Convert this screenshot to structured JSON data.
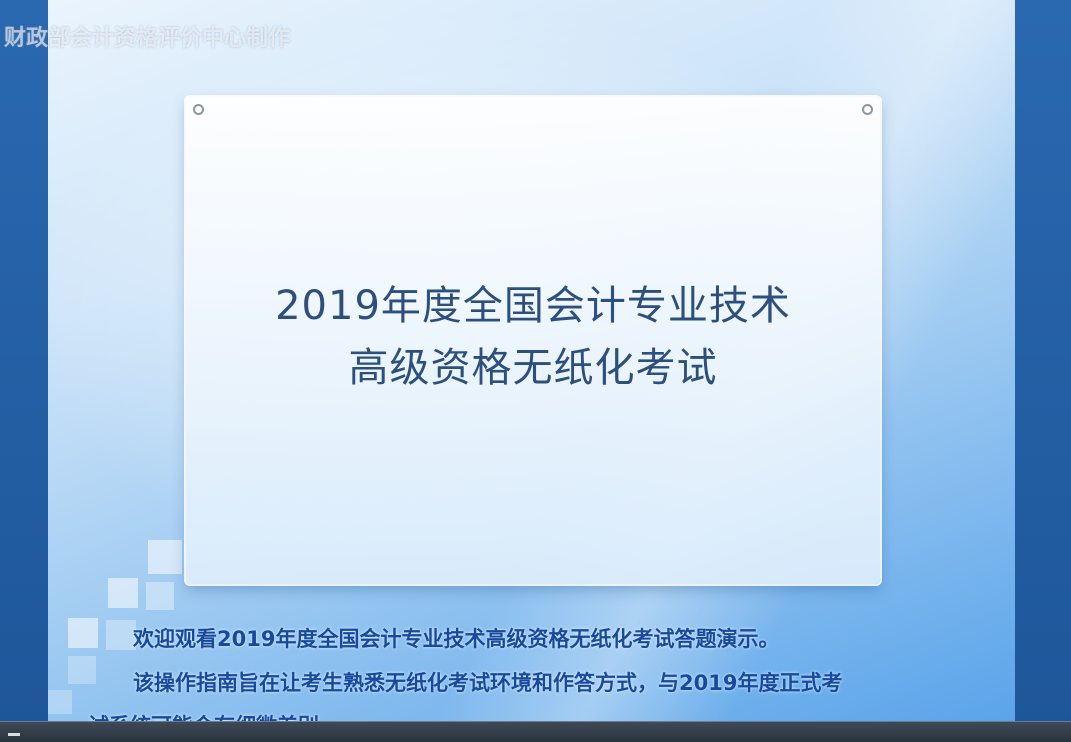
{
  "watermark": "财政部会计资格评价中心制作",
  "slide": {
    "title_line1": "2019年度全国会计专业技术",
    "title_line2": "高级资格无纸化考试"
  },
  "caption": {
    "line1": "欢迎观看2019年度全国会计专业技术高级资格无纸化考试答题演示。",
    "line2": "该操作指南旨在让考生熟悉无纸化考试环境和作答方式，与2019年度正式考",
    "line3": "试系统可能会有细微差别。"
  },
  "colors": {
    "title": "#2c4f7e",
    "caption": "#174a9e",
    "side_bar": "#1f5fa8"
  }
}
